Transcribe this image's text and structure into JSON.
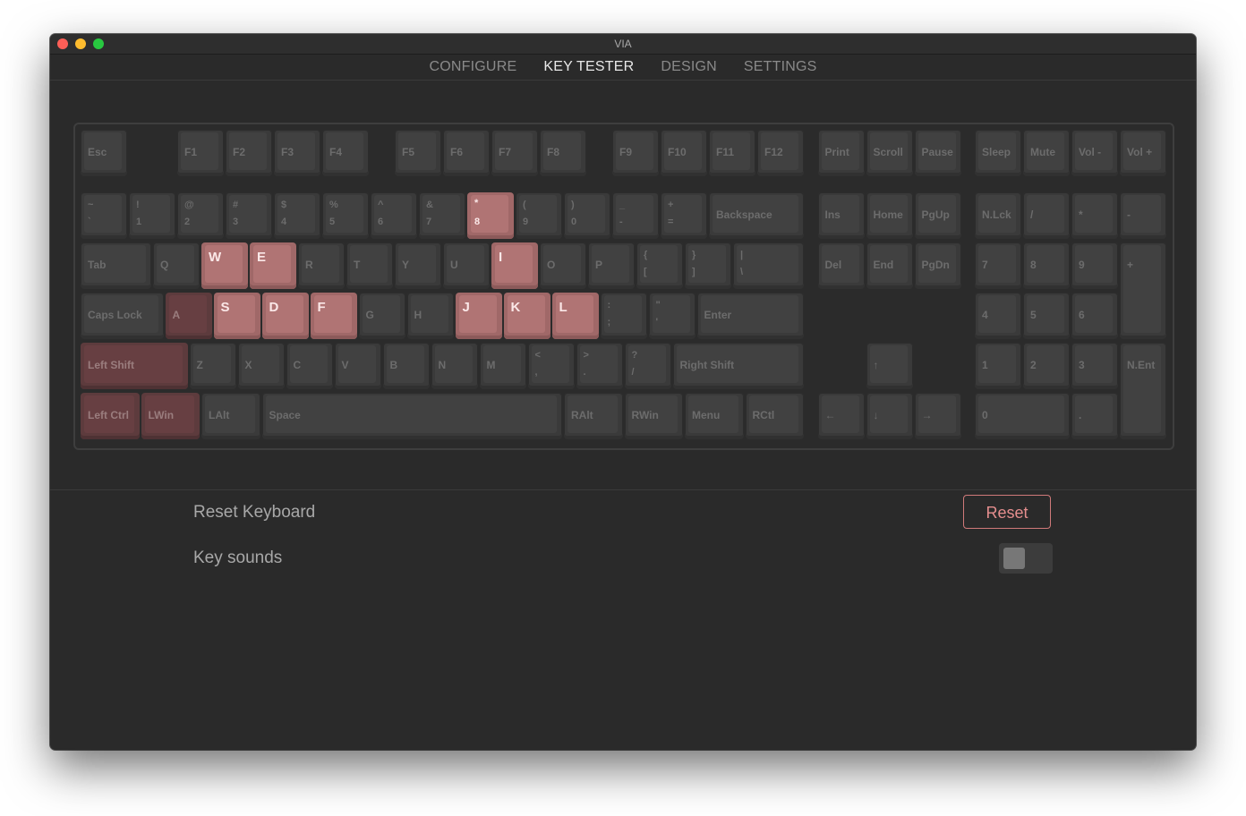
{
  "window": {
    "title": "VIA"
  },
  "nav": {
    "tabs": [
      {
        "label": "CONFIGURE",
        "active": false
      },
      {
        "label": "KEY TESTER",
        "active": true
      },
      {
        "label": "DESIGN",
        "active": false
      },
      {
        "label": "SETTINGS",
        "active": false
      }
    ]
  },
  "keyboard": {
    "colors": {
      "pressed": "#b07474",
      "previously_pressed": "#673f42",
      "idle": "#414141"
    },
    "keys": [
      {
        "label": "Esc"
      },
      {
        "label": "F1"
      },
      {
        "label": "F2"
      },
      {
        "label": "F3"
      },
      {
        "label": "F4"
      },
      {
        "label": "F5"
      },
      {
        "label": "F6"
      },
      {
        "label": "F7"
      },
      {
        "label": "F8"
      },
      {
        "label": "F9"
      },
      {
        "label": "F10"
      },
      {
        "label": "F11"
      },
      {
        "label": "F12"
      },
      {
        "label": "Print"
      },
      {
        "label": "Scroll"
      },
      {
        "label": "Pause"
      },
      {
        "label": "Sleep"
      },
      {
        "label": "Mute"
      },
      {
        "label": "Vol -"
      },
      {
        "label": "Vol +"
      },
      {
        "top": "~",
        "bottom": "`"
      },
      {
        "top": "!",
        "bottom": "1"
      },
      {
        "top": "@",
        "bottom": "2"
      },
      {
        "top": "#",
        "bottom": "3"
      },
      {
        "top": "$",
        "bottom": "4"
      },
      {
        "top": "%",
        "bottom": "5"
      },
      {
        "top": "^",
        "bottom": "6"
      },
      {
        "top": "&",
        "bottom": "7"
      },
      {
        "top": "*",
        "bottom": "8",
        "state": "pressed"
      },
      {
        "top": "(",
        "bottom": "9"
      },
      {
        "top": ")",
        "bottom": "0"
      },
      {
        "top": "_",
        "bottom": "-"
      },
      {
        "top": "+",
        "bottom": "="
      },
      {
        "label": "Backspace"
      },
      {
        "label": "Ins"
      },
      {
        "label": "Home"
      },
      {
        "label": "PgUp"
      },
      {
        "label": "N.Lck"
      },
      {
        "label": "/"
      },
      {
        "label": "*"
      },
      {
        "label": "-"
      },
      {
        "label": "Tab"
      },
      {
        "label": "Q"
      },
      {
        "label": "W",
        "state": "pressed"
      },
      {
        "label": "E",
        "state": "pressed"
      },
      {
        "label": "R"
      },
      {
        "label": "T"
      },
      {
        "label": "Y"
      },
      {
        "label": "U"
      },
      {
        "label": "I",
        "state": "pressed"
      },
      {
        "label": "O"
      },
      {
        "label": "P"
      },
      {
        "top": "{",
        "bottom": "["
      },
      {
        "top": "}",
        "bottom": "]"
      },
      {
        "top": "|",
        "bottom": "\\"
      },
      {
        "label": "Del"
      },
      {
        "label": "End"
      },
      {
        "label": "PgDn"
      },
      {
        "label": "7"
      },
      {
        "label": "8"
      },
      {
        "label": "9"
      },
      {
        "label": "+"
      },
      {
        "label": "Caps Lock"
      },
      {
        "label": "A",
        "state": "was"
      },
      {
        "label": "S",
        "state": "pressed"
      },
      {
        "label": "D",
        "state": "pressed"
      },
      {
        "label": "F",
        "state": "pressed"
      },
      {
        "label": "G"
      },
      {
        "label": "H"
      },
      {
        "label": "J",
        "state": "pressed"
      },
      {
        "label": "K",
        "state": "pressed"
      },
      {
        "label": "L",
        "state": "pressed"
      },
      {
        "top": ":",
        "bottom": ";"
      },
      {
        "top": "\"",
        "bottom": "'"
      },
      {
        "label": "Enter"
      },
      {
        "label": "4"
      },
      {
        "label": "5"
      },
      {
        "label": "6"
      },
      {
        "label": "Left Shift",
        "state": "was"
      },
      {
        "label": "Z"
      },
      {
        "label": "X"
      },
      {
        "label": "C"
      },
      {
        "label": "V"
      },
      {
        "label": "B"
      },
      {
        "label": "N"
      },
      {
        "label": "M"
      },
      {
        "top": "<",
        "bottom": ","
      },
      {
        "top": ">",
        "bottom": "."
      },
      {
        "top": "?",
        "bottom": "/"
      },
      {
        "label": "Right Shift"
      },
      {
        "label": "↑"
      },
      {
        "label": "1"
      },
      {
        "label": "2"
      },
      {
        "label": "3"
      },
      {
        "label": "N.Ent"
      },
      {
        "label": "Left Ctrl",
        "state": "was"
      },
      {
        "label": "LWin",
        "state": "was"
      },
      {
        "label": "LAlt"
      },
      {
        "label": "Space"
      },
      {
        "label": "RAlt"
      },
      {
        "label": "RWin"
      },
      {
        "label": "Menu"
      },
      {
        "label": "RCtl"
      },
      {
        "label": "←"
      },
      {
        "label": "↓"
      },
      {
        "label": "→"
      },
      {
        "label": "0"
      },
      {
        "label": "."
      }
    ]
  },
  "settings": {
    "reset_label": "Reset Keyboard",
    "reset_button": "Reset",
    "sounds_label": "Key sounds",
    "sounds_on": false
  }
}
